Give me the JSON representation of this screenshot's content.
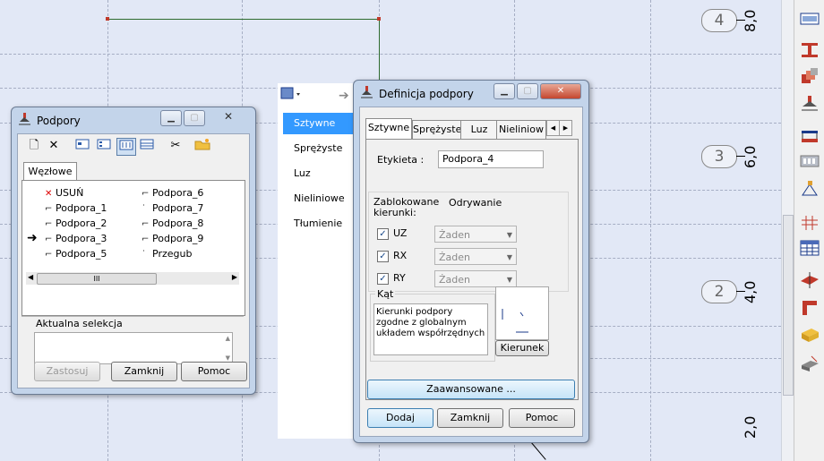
{
  "canvas": {
    "grid_bubbles": [
      "4",
      "3",
      "2"
    ],
    "axis_labels": [
      "8,0",
      "6,0",
      "4,0",
      "2,0"
    ],
    "colors": {
      "background": "#e2e8f6",
      "grid": "#a6aec4",
      "beam_red": "#c0392b",
      "beam_green": "#2e6b2e"
    }
  },
  "toolbar": {
    "icons": [
      "section-icon",
      "i-beam-icon",
      "layers-icon",
      "support-icon",
      "load-icon",
      "truss-icon",
      "node-icon",
      "grid-icon",
      "table-icon",
      "plate-icon",
      "angle-icon",
      "block-icon",
      "slab-icon"
    ]
  },
  "podpory": {
    "title": "Podpory",
    "tab": "Węzłowe",
    "items": [
      {
        "label": "USUŃ",
        "glyph": "✕"
      },
      {
        "label": "Podpora_6",
        "glyph": "⌐"
      },
      {
        "label": "Podpora_1",
        "glyph": "⌐"
      },
      {
        "label": "Podpora_7",
        "glyph": "˙"
      },
      {
        "label": "Podpora_2",
        "glyph": "⌐"
      },
      {
        "label": "Podpora_8",
        "glyph": "⌐"
      },
      {
        "label": "Podpora_3",
        "glyph": "⌐"
      },
      {
        "label": "Podpora_9",
        "glyph": "⌐"
      },
      {
        "label": "Podpora_5",
        "glyph": "⌐"
      },
      {
        "label": "Przegub",
        "glyph": "˙"
      }
    ],
    "scroll_thumb": "III",
    "selection_label": "Aktualna selekcja",
    "buttons": {
      "apply": "Zastosuj",
      "close": "Zamknij",
      "help": "Pomoc"
    }
  },
  "side_list": {
    "items": [
      "Sztywne",
      "Sprężyste",
      "Luz",
      "Nieliniowe",
      "Tłumienie"
    ],
    "selected": "Sztywne"
  },
  "definicja": {
    "title": "Definicja podpory",
    "tabs": [
      "Sztywne",
      "Sprężyste",
      "Luz",
      "Nieliniow"
    ],
    "label_caption": "Etykieta :",
    "label_value": "Podpora_4",
    "blocked_caption": "Zablokowane kierunki:",
    "detach_caption": "Odrywanie",
    "directions": [
      {
        "name": "UZ",
        "checked": true,
        "option": "Żaden"
      },
      {
        "name": "RX",
        "checked": true,
        "option": "Żaden"
      },
      {
        "name": "RY",
        "checked": true,
        "option": "Żaden"
      }
    ],
    "angle_caption": "Kąt",
    "angle_text": "Kierunki podpory zgodne z globalnym układem współrzędnych",
    "kierunki_button": "Kierunek",
    "advanced_button": "Zaawansowane ...",
    "buttons": {
      "add": "Dodaj",
      "close": "Zamknij",
      "help": "Pomoc"
    }
  }
}
